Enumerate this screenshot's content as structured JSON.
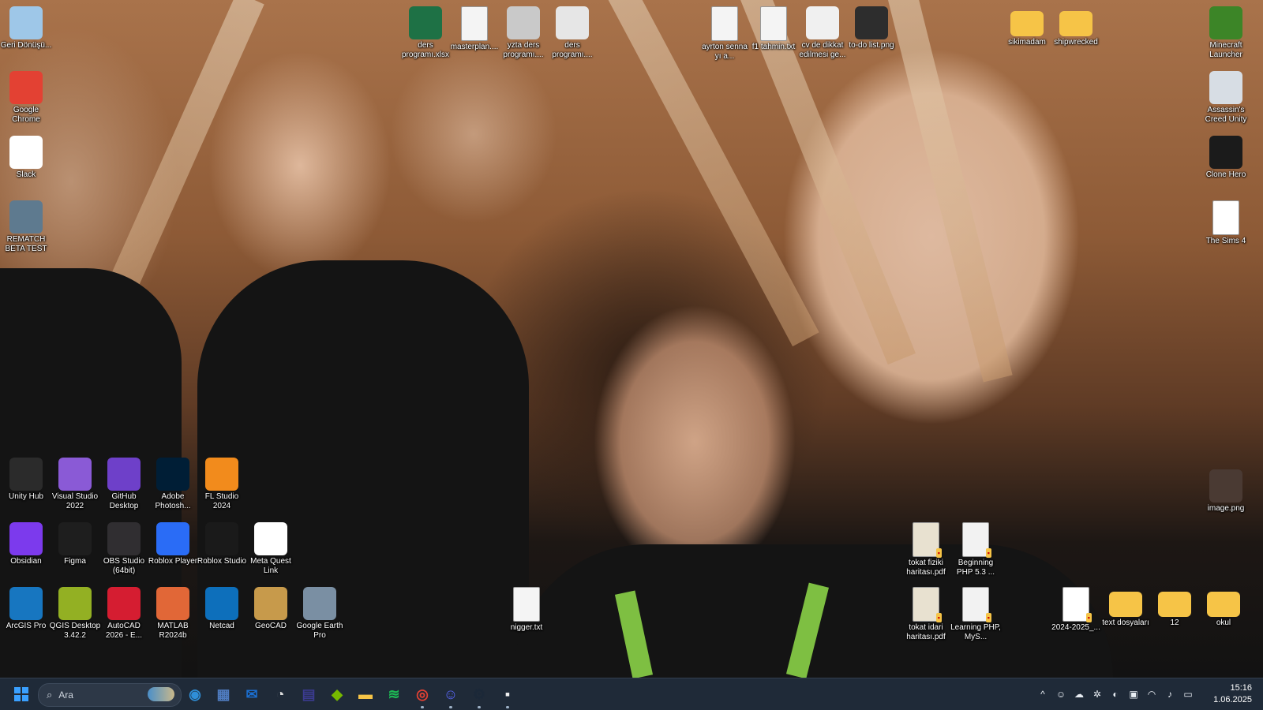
{
  "desktop": {
    "left_column": [
      {
        "label": "Geri Dönüşü...",
        "icon": "recycle-bin-icon",
        "color": "#9ec7e8"
      },
      {
        "label": "Google Chrome",
        "icon": "chrome-icon",
        "color": "#e34133"
      },
      {
        "label": "Slack",
        "icon": "slack-icon",
        "color": "#ffffff"
      },
      {
        "label": "REMATCH BETA TEST",
        "icon": "rematch-icon",
        "color": "#5e7a8f"
      }
    ],
    "top_files": [
      {
        "label": "ders programı.xlsx",
        "icon": "excel-icon",
        "color": "#1e7145"
      },
      {
        "label": "masterplan....",
        "icon": "document-icon",
        "color": "#f4f4f4"
      },
      {
        "label": "yzta ders programı....",
        "icon": "image-file-icon",
        "color": "#c9c9c9"
      },
      {
        "label": "ders programı....",
        "icon": "image-file-icon",
        "color": "#e6e6e6"
      },
      {
        "label": "ayrton senna yı a...",
        "icon": "document-icon",
        "color": "#f4f4f4"
      },
      {
        "label": "f1 tahmin.txt",
        "icon": "text-file-icon",
        "color": "#f4f4f4"
      },
      {
        "label": "cv de dikkat edilmesi ge...",
        "icon": "image-file-icon",
        "color": "#f0f0f0"
      },
      {
        "label": "to-do list.png",
        "icon": "image-file-icon",
        "color": "#2d2d2d"
      },
      {
        "label": "sikimadam",
        "icon": "folder-icon",
        "color": "#f6c447"
      },
      {
        "label": "shipwrecked",
        "icon": "folder-icon",
        "color": "#f6c447"
      }
    ],
    "right_column": [
      {
        "label": "Minecraft Launcher",
        "icon": "minecraft-icon",
        "color": "#3c8527"
      },
      {
        "label": "Assassin's Creed Unity",
        "icon": "assassins-creed-icon",
        "color": "#d7dde4"
      },
      {
        "label": "Clone Hero",
        "icon": "clone-hero-icon",
        "color": "#1b1b1b"
      },
      {
        "label": "The Sims 4",
        "icon": "document-icon",
        "color": "#ffffff"
      },
      {
        "label": "image.png",
        "icon": "image-file-icon",
        "color": "#4a3a33"
      }
    ],
    "app_grid": [
      {
        "label": "Unity Hub",
        "icon": "unity-icon",
        "color": "#2b2b2b"
      },
      {
        "label": "Visual Studio 2022",
        "icon": "visual-studio-icon",
        "color": "#8a5ad6"
      },
      {
        "label": "GitHub Desktop",
        "icon": "github-icon",
        "color": "#6e40c9"
      },
      {
        "label": "Adobe Photosh...",
        "icon": "photoshop-icon",
        "color": "#001e36"
      },
      {
        "label": "FL Studio 2024",
        "icon": "fl-studio-icon",
        "color": "#f28b1c"
      },
      {
        "label": "Obsidian",
        "icon": "obsidian-icon",
        "color": "#7c3aed"
      },
      {
        "label": "Figma",
        "icon": "figma-icon",
        "color": "#1e1e1e"
      },
      {
        "label": "OBS Studio (64bit)",
        "icon": "obs-icon",
        "color": "#302e31"
      },
      {
        "label": "Roblox Player",
        "icon": "roblox-player-icon",
        "color": "#2a6cf6"
      },
      {
        "label": "Roblox Studio",
        "icon": "roblox-studio-icon",
        "color": "#1a1a1a"
      },
      {
        "label": "Meta Quest Link",
        "icon": "meta-icon",
        "color": "#ffffff"
      },
      {
        "label": "ArcGIS Pro",
        "icon": "arcgis-icon",
        "color": "#1776c0"
      },
      {
        "label": "QGIS Desktop 3.42.2",
        "icon": "qgis-icon",
        "color": "#93b023"
      },
      {
        "label": "AutoCAD 2026 - E...",
        "icon": "autocad-icon",
        "color": "#d51d31"
      },
      {
        "label": "MATLAB R2024b",
        "icon": "matlab-icon",
        "color": "#e16737"
      },
      {
        "label": "Netcad",
        "icon": "netcad-icon",
        "color": "#0d6fbb"
      },
      {
        "label": "GeoCAD",
        "icon": "geocad-icon",
        "color": "#c79a4b"
      },
      {
        "label": "Google Earth Pro",
        "icon": "google-earth-icon",
        "color": "#7a8fa3"
      }
    ],
    "middle_files": [
      {
        "label": "nigger.txt",
        "icon": "text-file-icon",
        "color": "#f4f4f4"
      }
    ],
    "bottom_right_files": [
      {
        "label": "tokat fiziki haritası.pdf",
        "icon": "pdf-icon",
        "color": "#e8e1d0"
      },
      {
        "label": "Beginning PHP 5.3 ...",
        "icon": "pdf-icon",
        "color": "#f2f2f2"
      },
      {
        "label": "tokat idari haritası.pdf",
        "icon": "pdf-icon",
        "color": "#e8e1d0"
      },
      {
        "label": "Learning PHP, MyS...",
        "icon": "pdf-icon",
        "color": "#f2f2f2"
      },
      {
        "label": "2024-2025_...",
        "icon": "pdf-icon",
        "color": "#ffffff"
      },
      {
        "label": "text dosyaları",
        "icon": "folder-icon",
        "color": "#f6c447"
      },
      {
        "label": "12",
        "icon": "folder-icon",
        "color": "#f6c447"
      },
      {
        "label": "okul",
        "icon": "folder-icon",
        "color": "#f6c447"
      }
    ]
  },
  "taskbar": {
    "search_placeholder": "Ara",
    "pinned": [
      {
        "name": "edge-beta-icon",
        "color": "#2f8fd8",
        "glyph": "◉"
      },
      {
        "name": "control-panel-icon",
        "color": "#4f7cc0",
        "glyph": "▦"
      },
      {
        "name": "mail-icon",
        "color": "#1b6fd1",
        "glyph": "✉"
      },
      {
        "name": "clock-app-icon",
        "color": "#dcdcdc",
        "glyph": "◔"
      },
      {
        "name": "visual-studio-taskbar-icon",
        "color": "#3b3b8f",
        "glyph": "▤"
      },
      {
        "name": "nvidia-icon",
        "color": "#76b900",
        "glyph": "◆"
      },
      {
        "name": "file-explorer-icon",
        "color": "#f6c447",
        "glyph": "▬"
      },
      {
        "name": "spotify-icon",
        "color": "#1db954",
        "glyph": "≋"
      },
      {
        "name": "chrome-taskbar-icon",
        "color": "#e34133",
        "glyph": "◎"
      },
      {
        "name": "discord-icon",
        "color": "#5865f2",
        "glyph": "☺"
      },
      {
        "name": "steam-icon",
        "color": "#1b2838",
        "glyph": "⚙"
      },
      {
        "name": "notes-app-icon",
        "color": "#f1f1f1",
        "glyph": "▪"
      }
    ],
    "tray": [
      {
        "name": "tray-overflow-icon",
        "glyph": "^"
      },
      {
        "name": "discord-tray-icon",
        "glyph": "☺"
      },
      {
        "name": "cloud-tray-icon",
        "glyph": "☁"
      },
      {
        "name": "settings-tray-icon",
        "glyph": "✲"
      },
      {
        "name": "shield-tray-icon",
        "glyph": "◐"
      },
      {
        "name": "app-tray-icon",
        "glyph": "▣"
      },
      {
        "name": "wifi-icon",
        "glyph": "◠"
      },
      {
        "name": "volume-icon",
        "glyph": "♪"
      },
      {
        "name": "battery-icon",
        "glyph": "▭"
      }
    ],
    "time": "15:16",
    "date": "1.06.2025"
  }
}
